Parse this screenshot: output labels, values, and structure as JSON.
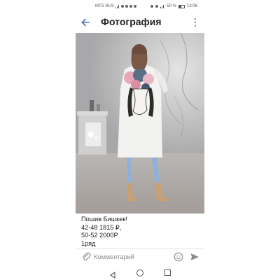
{
  "status_bar": {
    "carrier": "MTS RUS",
    "battery": "50 %",
    "time": "13:06"
  },
  "header": {
    "title": "Фотография",
    "back_icon": "arrow-left-icon",
    "menu_icon": "more-vertical-icon"
  },
  "caption": {
    "lines": [
      "Пошив Бишкек!",
      "42-48 1815 ₽,",
      "50-52 2000Р",
      "1ряд"
    ]
  },
  "comment_bar": {
    "placeholder": "Комментарий",
    "attach_icon": "paperclip-icon",
    "emoji_icon": "emoji-icon",
    "send_icon": "send-icon"
  },
  "nav_bar": {
    "icons": [
      "nav-back-icon",
      "nav-home-icon",
      "nav-recent-icon"
    ]
  },
  "colors": {
    "accent": "#4a78b8",
    "text": "#222222",
    "placeholder": "#8a8a8a"
  }
}
